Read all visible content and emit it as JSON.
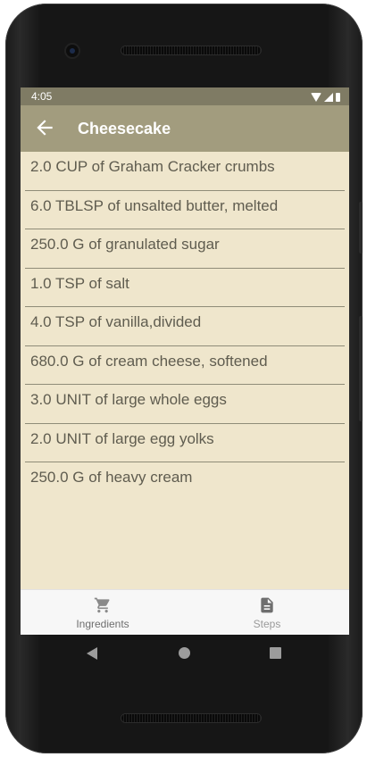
{
  "status_bar": {
    "time": "4:05",
    "icons": [
      "wifi-icon",
      "signal-icon",
      "battery-icon"
    ]
  },
  "app_bar": {
    "back_icon": "arrow-left-icon",
    "title": "Cheesecake"
  },
  "ingredients": [
    "2.0 CUP of Graham Cracker crumbs",
    "6.0 TBLSP of unsalted butter, melted",
    "250.0 G of granulated sugar",
    "1.0 TSP of salt",
    "4.0 TSP of vanilla,divided",
    "680.0 G of cream cheese, softened",
    "3.0 UNIT of large whole eggs",
    "2.0 UNIT of large egg yolks",
    "250.0 G of heavy cream"
  ],
  "bottom_nav": {
    "ingredients": {
      "label": "Ingredients",
      "icon": "cart-icon"
    },
    "steps": {
      "label": "Steps",
      "icon": "document-icon"
    }
  },
  "system_nav": [
    "back-triangle-icon",
    "home-circle-icon",
    "recents-square-icon"
  ],
  "colors": {
    "app_bar": "#a29c7e",
    "status_bar": "#7f7b64",
    "list_background": "#efe6cc",
    "list_text": "#5f5c4f",
    "divider": "#8f8c78",
    "bottom_nav_background": "#f7f7f7"
  }
}
